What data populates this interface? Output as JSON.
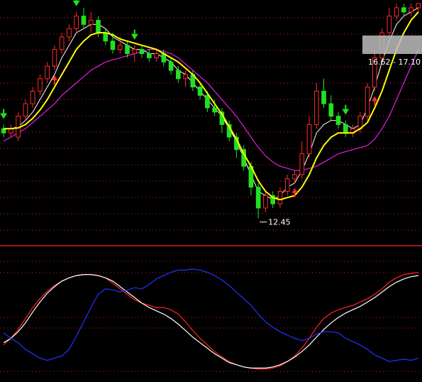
{
  "colors": {
    "background": "#000000",
    "up": "#ff2a2a",
    "down": "#22e022",
    "ma_fast": "#ffffff",
    "ma_mid": "#ffff00",
    "ma_slow": "#e020e0",
    "osc_red": "#ff2222",
    "osc_white": "#ffffff",
    "osc_blue": "#2233ff",
    "grid": "#cc2222",
    "separator": "#ff2222"
  },
  "annotations": {
    "low_price_label": "12.45",
    "range_label": "16.62 - 17.10"
  },
  "chart_data": [
    {
      "type": "candlestick",
      "title": "",
      "ylim": [
        11.9,
        17.6
      ],
      "grid": true,
      "candles": [
        {
          "o": 14.6,
          "c": 14.5,
          "h": 14.7,
          "l": 14.4
        },
        {
          "o": 14.5,
          "c": 14.6,
          "h": 14.7,
          "l": 14.4
        },
        {
          "o": 14.4,
          "c": 14.9,
          "h": 15.0,
          "l": 14.3
        },
        {
          "o": 14.9,
          "c": 15.2,
          "h": 15.3,
          "l": 14.8
        },
        {
          "o": 15.2,
          "c": 15.5,
          "h": 15.6,
          "l": 15.1
        },
        {
          "o": 15.5,
          "c": 15.8,
          "h": 15.9,
          "l": 15.4
        },
        {
          "o": 15.8,
          "c": 16.1,
          "h": 16.2,
          "l": 15.7
        },
        {
          "o": 16.1,
          "c": 16.5,
          "h": 16.6,
          "l": 16.0
        },
        {
          "o": 16.5,
          "c": 16.8,
          "h": 16.9,
          "l": 16.4
        },
        {
          "o": 16.8,
          "c": 17.0,
          "h": 17.1,
          "l": 16.7
        },
        {
          "o": 17.0,
          "c": 17.3,
          "h": 17.4,
          "l": 16.9
        },
        {
          "o": 17.3,
          "c": 17.1,
          "h": 17.5,
          "l": 17.0
        },
        {
          "o": 17.1,
          "c": 17.2,
          "h": 17.4,
          "l": 16.9
        },
        {
          "o": 17.2,
          "c": 16.9,
          "h": 17.3,
          "l": 16.8
        },
        {
          "o": 16.9,
          "c": 16.7,
          "h": 17.0,
          "l": 16.6
        },
        {
          "o": 16.7,
          "c": 16.5,
          "h": 16.9,
          "l": 16.4
        },
        {
          "o": 16.5,
          "c": 16.6,
          "h": 16.8,
          "l": 16.4
        },
        {
          "o": 16.6,
          "c": 16.4,
          "h": 16.7,
          "l": 16.3
        },
        {
          "o": 16.4,
          "c": 16.5,
          "h": 16.6,
          "l": 16.2
        },
        {
          "o": 16.5,
          "c": 16.4,
          "h": 16.6,
          "l": 16.3
        },
        {
          "o": 16.4,
          "c": 16.3,
          "h": 16.5,
          "l": 16.2
        },
        {
          "o": 16.3,
          "c": 16.4,
          "h": 16.5,
          "l": 16.2
        },
        {
          "o": 16.4,
          "c": 16.2,
          "h": 16.5,
          "l": 16.1
        },
        {
          "o": 16.2,
          "c": 16.0,
          "h": 16.3,
          "l": 15.9
        },
        {
          "o": 16.0,
          "c": 15.8,
          "h": 16.1,
          "l": 15.7
        },
        {
          "o": 15.8,
          "c": 15.9,
          "h": 16.0,
          "l": 15.6
        },
        {
          "o": 15.9,
          "c": 15.6,
          "h": 16.0,
          "l": 15.5
        },
        {
          "o": 15.6,
          "c": 15.4,
          "h": 15.7,
          "l": 15.3
        },
        {
          "o": 15.4,
          "c": 15.1,
          "h": 15.5,
          "l": 15.0
        },
        {
          "o": 15.1,
          "c": 15.0,
          "h": 15.3,
          "l": 14.9
        },
        {
          "o": 15.0,
          "c": 14.7,
          "h": 15.1,
          "l": 14.5
        },
        {
          "o": 14.7,
          "c": 14.4,
          "h": 14.8,
          "l": 14.3
        },
        {
          "o": 14.4,
          "c": 14.1,
          "h": 14.5,
          "l": 13.9
        },
        {
          "o": 14.1,
          "c": 13.7,
          "h": 14.2,
          "l": 13.6
        },
        {
          "o": 13.7,
          "c": 13.2,
          "h": 13.8,
          "l": 13.0
        },
        {
          "o": 13.2,
          "c": 12.7,
          "h": 13.3,
          "l": 12.45
        },
        {
          "o": 12.7,
          "c": 13.0,
          "h": 13.1,
          "l": 12.6
        },
        {
          "o": 13.0,
          "c": 12.8,
          "h": 13.1,
          "l": 12.7
        },
        {
          "o": 12.8,
          "c": 13.1,
          "h": 13.2,
          "l": 12.7
        },
        {
          "o": 13.1,
          "c": 13.4,
          "h": 13.5,
          "l": 13.0
        },
        {
          "o": 13.4,
          "c": 13.5,
          "h": 13.6,
          "l": 13.3
        },
        {
          "o": 13.5,
          "c": 14.0,
          "h": 14.3,
          "l": 13.4
        },
        {
          "o": 14.0,
          "c": 14.7,
          "h": 14.9,
          "l": 13.9
        },
        {
          "o": 14.7,
          "c": 15.5,
          "h": 15.7,
          "l": 14.6
        },
        {
          "o": 15.5,
          "c": 15.2,
          "h": 15.8,
          "l": 15.1
        },
        {
          "o": 15.2,
          "c": 14.9,
          "h": 15.4,
          "l": 14.8
        },
        {
          "o": 14.9,
          "c": 14.7,
          "h": 15.0,
          "l": 14.6
        },
        {
          "o": 14.7,
          "c": 14.5,
          "h": 14.8,
          "l": 14.4
        },
        {
          "o": 14.5,
          "c": 14.6,
          "h": 14.7,
          "l": 14.4
        },
        {
          "o": 14.6,
          "c": 14.9,
          "h": 15.0,
          "l": 14.5
        },
        {
          "o": 14.9,
          "c": 15.6,
          "h": 15.7,
          "l": 14.8
        },
        {
          "o": 15.6,
          "c": 16.3,
          "h": 16.5,
          "l": 15.5
        },
        {
          "o": 16.3,
          "c": 16.9,
          "h": 17.0,
          "l": 16.2
        },
        {
          "o": 16.9,
          "c": 17.3,
          "h": 17.5,
          "l": 16.8
        },
        {
          "o": 17.3,
          "c": 17.5,
          "h": 17.6,
          "l": 17.2
        },
        {
          "o": 17.5,
          "c": 17.4,
          "h": 17.6,
          "l": 17.3
        },
        {
          "o": 17.4,
          "c": 17.5,
          "h": 17.6,
          "l": 17.3
        },
        {
          "o": 17.5,
          "c": 17.6,
          "h": 17.6,
          "l": 17.4
        }
      ],
      "ma_fast": [
        14.6,
        14.6,
        14.65,
        14.8,
        15.0,
        15.3,
        15.6,
        15.9,
        16.3,
        16.6,
        16.9,
        17.0,
        17.1,
        17.1,
        17.0,
        16.8,
        16.7,
        16.6,
        16.5,
        16.5,
        16.4,
        16.4,
        16.3,
        16.2,
        16.0,
        15.9,
        15.7,
        15.5,
        15.3,
        15.1,
        14.9,
        14.6,
        14.3,
        13.9,
        13.5,
        13.1,
        13.0,
        12.9,
        13.0,
        13.2,
        13.3,
        13.6,
        14.0,
        14.5,
        14.7,
        14.8,
        14.8,
        14.7,
        14.6,
        14.7,
        15.1,
        15.6,
        16.2,
        16.7,
        17.1,
        17.3,
        17.4,
        17.5
      ],
      "ma_mid": [
        14.6,
        14.6,
        14.62,
        14.7,
        14.85,
        15.05,
        15.3,
        15.6,
        15.9,
        16.2,
        16.5,
        16.7,
        16.85,
        16.9,
        16.9,
        16.85,
        16.75,
        16.7,
        16.65,
        16.6,
        16.55,
        16.5,
        16.4,
        16.3,
        16.2,
        16.05,
        15.9,
        15.7,
        15.45,
        15.2,
        14.95,
        14.65,
        14.35,
        14.0,
        13.7,
        13.35,
        13.1,
        12.95,
        12.9,
        12.95,
        13.0,
        13.2,
        13.5,
        13.9,
        14.2,
        14.4,
        14.5,
        14.5,
        14.5,
        14.6,
        14.75,
        15.1,
        15.5,
        16.0,
        16.5,
        16.9,
        17.2,
        17.4
      ],
      "ma_slow": [
        14.3,
        14.4,
        14.5,
        14.6,
        14.75,
        14.9,
        15.05,
        15.2,
        15.4,
        15.55,
        15.7,
        15.85,
        16.0,
        16.1,
        16.2,
        16.25,
        16.3,
        16.35,
        16.4,
        16.45,
        16.5,
        16.5,
        16.45,
        16.4,
        16.3,
        16.15,
        16.0,
        15.85,
        15.7,
        15.5,
        15.3,
        15.1,
        14.9,
        14.65,
        14.4,
        14.15,
        13.95,
        13.8,
        13.7,
        13.65,
        13.6,
        13.6,
        13.65,
        13.7,
        13.8,
        13.9,
        14.0,
        14.05,
        14.1,
        14.15,
        14.2,
        14.35,
        14.6,
        14.9,
        15.3,
        15.7,
        16.1,
        16.5
      ],
      "buy_signals": [
        7,
        40,
        51
      ],
      "sell_signals": [
        0,
        10,
        18,
        47
      ],
      "low_marker": {
        "index": 35,
        "value": 12.45
      },
      "range_marker": {
        "low": 16.62,
        "high": 17.1
      }
    },
    {
      "type": "line",
      "title": "",
      "ylim": [
        0,
        100
      ],
      "grid": true,
      "series": [
        {
          "values": [
            24,
            30,
            38,
            48,
            58,
            66,
            73,
            78,
            82,
            85,
            87,
            88,
            88,
            87,
            85,
            80,
            75,
            70,
            65,
            62,
            60,
            58,
            58,
            56,
            52,
            45,
            37,
            30,
            24,
            18,
            13,
            9,
            6,
            4,
            3,
            2,
            2,
            3,
            5,
            9,
            14,
            21,
            30,
            40,
            48,
            53,
            56,
            58,
            60,
            63,
            66,
            70,
            75,
            81,
            85,
            88,
            89,
            90
          ]
        },
        {
          "values": [
            26,
            30,
            36,
            44,
            54,
            63,
            71,
            77,
            82,
            85,
            87,
            88,
            88,
            87,
            85,
            82,
            77,
            72,
            67,
            62,
            58,
            55,
            52,
            48,
            43,
            37,
            31,
            26,
            21,
            16,
            12,
            8,
            6,
            4,
            3,
            3,
            3,
            4,
            6,
            9,
            13,
            18,
            24,
            31,
            38,
            44,
            49,
            53,
            56,
            59,
            63,
            67,
            72,
            77,
            81,
            84,
            86,
            87
          ]
        },
        {
          "values": [
            35,
            30,
            26,
            20,
            16,
            12,
            10,
            12,
            14,
            20,
            32,
            45,
            58,
            70,
            75,
            74,
            72,
            74,
            76,
            75,
            79,
            84,
            87,
            90,
            92,
            92,
            93,
            92,
            90,
            87,
            83,
            78,
            72,
            66,
            60,
            52,
            45,
            40,
            36,
            33,
            30,
            28,
            30,
            34,
            36,
            36,
            35,
            30,
            27,
            24,
            20,
            15,
            12,
            9,
            10,
            11,
            10,
            12
          ]
        }
      ]
    }
  ]
}
